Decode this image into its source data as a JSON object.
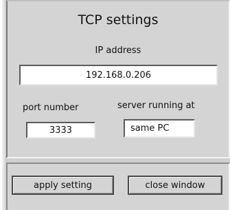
{
  "dialog": {
    "title": "TCP settings"
  },
  "ip": {
    "label": "IP address",
    "value": "192.168.0.206"
  },
  "port": {
    "label": "port number",
    "value": "3333"
  },
  "server": {
    "label": "server running at",
    "value": "same PC"
  },
  "buttons": {
    "apply_label": "apply setting",
    "close_label": "close window"
  }
}
